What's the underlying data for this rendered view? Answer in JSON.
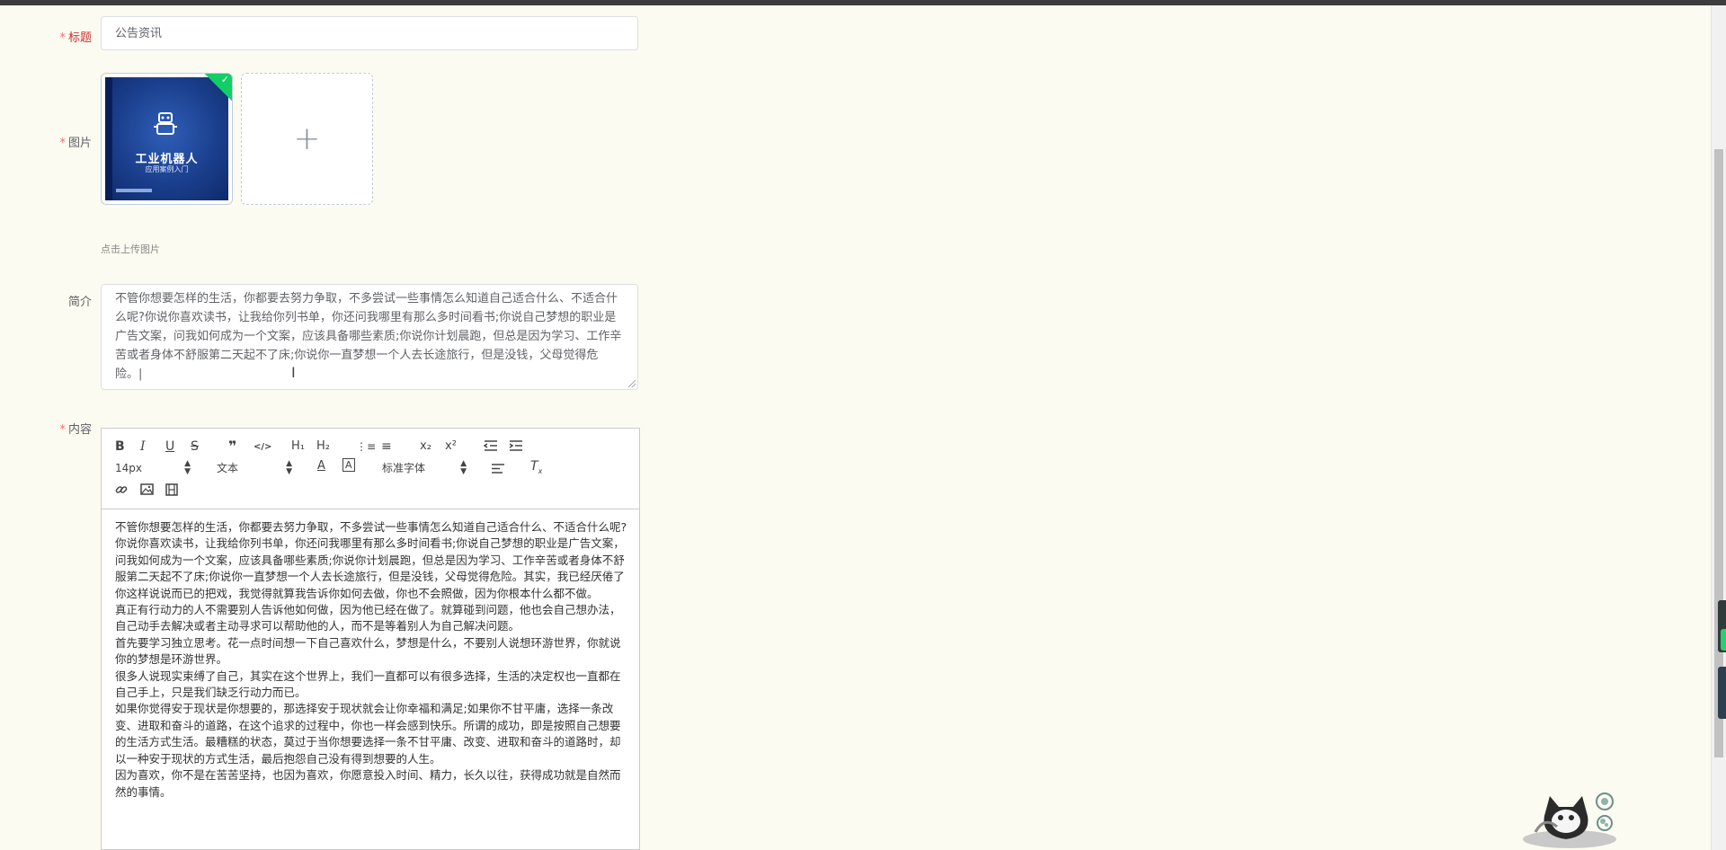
{
  "form": {
    "title": {
      "label": "标题",
      "value": "公告资讯"
    },
    "image": {
      "label": "图片",
      "upload_tip": "点击上传图片",
      "add_icon": "plus-icon",
      "uploaded": {
        "book_title": "工业机器人",
        "book_subtitle": "应用案例入门"
      }
    },
    "intro": {
      "label": "简介",
      "value": "不管你想要怎样的生活，你都要去努力争取，不多尝试一些事情怎么知道自己适合什么、不适合什么呢?你说你喜欢读书，让我给你列书单，你还问我哪里有那么多时间看书;你说自己梦想的职业是广告文案，问我如何成为一个文案，应该具备哪些素质;你说你计划晨跑，但总是因为学习、工作辛苦或者身体不舒服第二天起不了床;你说你一直梦想一个人去长途旅行，但是没钱，父母觉得危险。|"
    },
    "content": {
      "label": "内容",
      "toolbar": {
        "bold": "B",
        "italic": "I",
        "underline": "U",
        "strike": "S",
        "quote": "❞",
        "code": "</>",
        "h1": "H₁",
        "h2": "H₂",
        "ordered_list": "⋮≡",
        "bullet_list": "≡",
        "sub": "x₂",
        "sup": "x²",
        "font_size": "14px",
        "header": "文本",
        "font": "标准字体",
        "icons": [
          "bold-icon",
          "italic-icon",
          "underline-icon",
          "strike-icon",
          "quote-icon",
          "code-icon",
          "h1-icon",
          "h2-icon",
          "ordered-list-icon",
          "bullet-list-icon",
          "subscript-icon",
          "superscript-icon",
          "outdent-icon",
          "indent-icon",
          "font-color-icon",
          "background-color-icon",
          "align-icon",
          "clear-format-icon",
          "link-icon",
          "image-icon",
          "video-icon"
        ]
      },
      "paragraphs": [
        "不管你想要怎样的生活，你都要去努力争取，不多尝试一些事情怎么知道自己适合什么、不适合什么呢?",
        "你说你喜欢读书，让我给你列书单，你还问我哪里有那么多时间看书;你说自己梦想的职业是广告文案，问我如何成为一个文案，应该具备哪些素质;你说你计划晨跑，但总是因为学习、工作辛苦或者身体不舒服第二天起不了床;你说你一直梦想一个人去长途旅行，但是没钱，父母觉得危险。其实，我已经厌倦了你这样说说而已的把戏，我觉得就算我告诉你如何去做，你也不会照做，因为你根本什么都不做。",
        "真正有行动力的人不需要别人告诉他如何做，因为他已经在做了。就算碰到问题，他也会自己想办法，自己动手去解决或者主动寻求可以帮助他的人，而不是等着别人为自己解决问题。",
        "首先要学习独立思考。花一点时间想一下自己喜欢什么，梦想是什么，不要别人说想环游世界，你就说你的梦想是环游世界。",
        "很多人说现实束缚了自己，其实在这个世界上，我们一直都可以有很多选择，生活的决定权也一直都在自己手上，只是我们缺乏行动力而已。",
        "如果你觉得安于现状是你想要的，那选择安于现状就会让你幸福和满足;如果你不甘平庸，选择一条改变、进取和奋斗的道路，在这个追求的过程中，你也一样会感到快乐。所谓的成功，即是按照自己想要的生活方式生活。最糟糕的状态，莫过于当你想要选择一条不甘平庸、改变、进取和奋斗的道路时，却以一种安于现状的方式生活，最后抱怨自己没有得到想要的人生。",
        "因为喜欢，你不是在苦苦坚持，也因为喜欢，你愿意投入时间、精力，长久以往，获得成功就是自然而然的事情。"
      ]
    }
  },
  "colors": {
    "page_bg": "#fcfbf1",
    "required": "#f56c6c",
    "check_badge": "#13ce66",
    "book_cover": "#1b3f8d"
  }
}
